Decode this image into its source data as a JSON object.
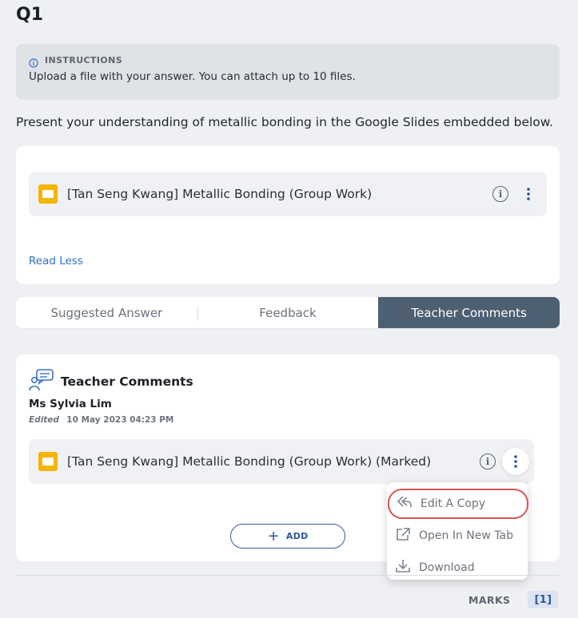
{
  "question": {
    "title": "Q1"
  },
  "instructions": {
    "label": "INSTRUCTIONS",
    "text": "Upload a file with your answer. You can attach up to 10 files."
  },
  "prompt": "Present your understanding of metallic bonding in the Google Slides embedded below.",
  "attachment": {
    "name": "[Tan Seng Kwang] Metallic Bonding (Group Work)",
    "icon": "google-slides-icon"
  },
  "read_less": "Read Less",
  "tabs": [
    {
      "label": "Suggested Answer",
      "active": false
    },
    {
      "label": "Feedback",
      "active": false
    },
    {
      "label": "Teacher Comments",
      "active": true
    }
  ],
  "teacher_comments": {
    "title": "Teacher Comments",
    "teacher_name": "Ms Sylvia Lim",
    "edited_label": "Edited",
    "edited_date": "10 May 2023 04:23 PM",
    "file_name": "[Tan Seng Kwang] Metallic Bonding (Group Work) (Marked)",
    "add_label": "ADD"
  },
  "context_menu": {
    "items": [
      {
        "label": "Edit A Copy",
        "icon": "reply-icon"
      },
      {
        "label": "Open In New Tab",
        "icon": "external-link-icon"
      },
      {
        "label": "Download",
        "icon": "download-icon"
      }
    ]
  },
  "marks": {
    "label": "MARKS",
    "value": "[1]"
  },
  "colors": {
    "accent": "#2f5597",
    "active_tab": "#4f5f72",
    "slides_yellow": "#f4b400",
    "focus_ring": "#d9534f",
    "link": "#2f6fc4"
  }
}
